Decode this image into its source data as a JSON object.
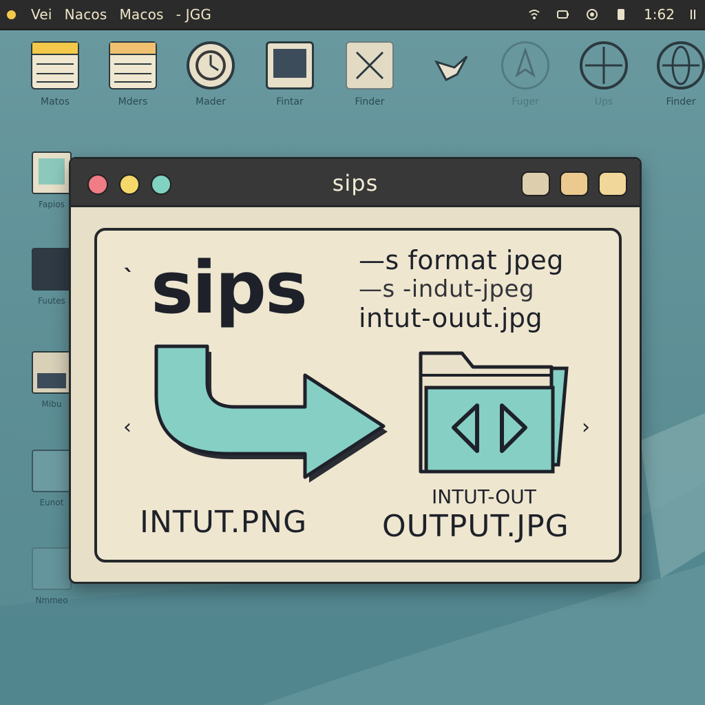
{
  "menubar": {
    "items": [
      "Vei",
      "Nacos",
      "Macos",
      "- ⁢⁢⁢",
      "JGG"
    ],
    "item1": "Vei",
    "item2": "Nacos",
    "item3": "Macos",
    "item4": "- JGG",
    "clock": "1:62",
    "status_icons": [
      "wifi-icon",
      "battery-icon",
      "user-icon",
      "storage-icon"
    ]
  },
  "desktop_icons": {
    "top": [
      {
        "label": "Matos",
        "icon": "notes-icon"
      },
      {
        "label": "Mders",
        "icon": "notes-icon"
      },
      {
        "label": "Mader",
        "icon": "clock-icon"
      },
      {
        "label": "Fintar",
        "icon": "image-icon"
      },
      {
        "label": "Finder",
        "icon": "finder-icon"
      },
      {
        "label": "",
        "icon": "bird-icon"
      },
      {
        "label": "Fuger",
        "icon": "compass-icon"
      },
      {
        "label": "Ups",
        "icon": "globe-icon"
      },
      {
        "label": "Finder",
        "icon": "globe-icon"
      }
    ],
    "left": [
      {
        "label": "Fapios",
        "icon": "picture-icon"
      },
      {
        "label": "Fuutes",
        "icon": "calendar-icon"
      },
      {
        "label": "Mibu",
        "icon": "photo-icon"
      },
      {
        "label": "Eunot",
        "icon": "chart-icon"
      },
      {
        "label": "Nmmeo",
        "icon": "document-icon"
      }
    ]
  },
  "window": {
    "title": "sips",
    "content": {
      "command_name": "sips",
      "command_line1": "—s format jpeg",
      "command_line2": "—s -indut-jpeg",
      "command_line3": "intut-ouut.jpg",
      "input_file": "INTUT.PNG",
      "output_caption": "INTUT-OUT",
      "output_file": "OUTPUT.JPG"
    }
  },
  "colors": {
    "accent_teal": "#86cfc4",
    "traffic_red": "#f07c86",
    "traffic_yellow": "#f4d86a",
    "traffic_green": "#7fd3c0",
    "window_bg": "#e7dfc7"
  }
}
